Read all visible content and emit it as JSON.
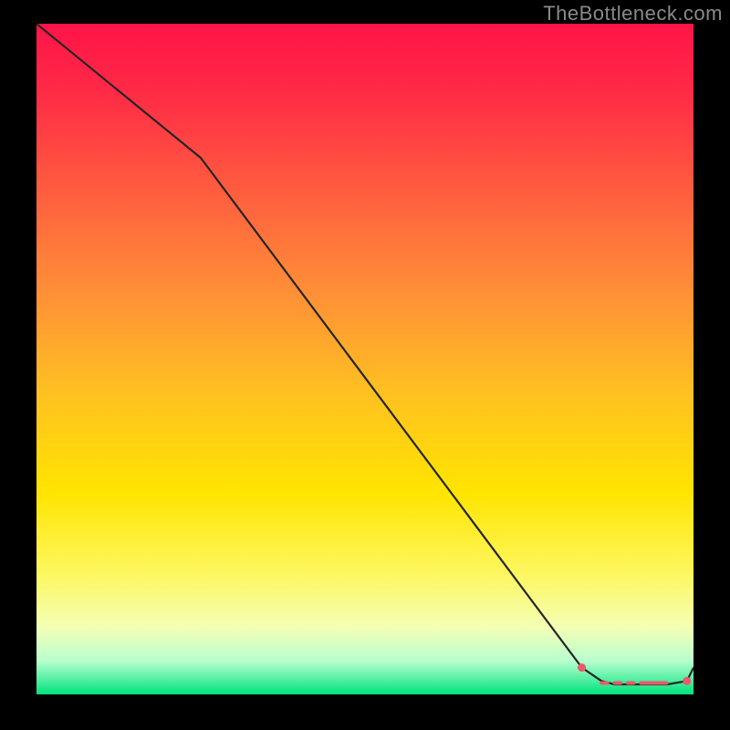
{
  "attribution": "TheBottleneck.com",
  "colors": {
    "top": "#ff1648",
    "mid": "#ffe500",
    "green": "#00e27d",
    "black": "#000000",
    "curve": "#252525",
    "marker": "#ed586c"
  },
  "chart_data": {
    "type": "line",
    "title": "",
    "xlabel": "",
    "ylabel": "",
    "xlim": [
      0,
      100
    ],
    "ylim": [
      0,
      100
    ],
    "grid": false,
    "legend": false,
    "x": [
      0,
      25,
      83,
      86,
      88,
      90,
      92,
      93,
      94,
      95,
      96,
      99,
      100
    ],
    "values": [
      100,
      80,
      4,
      2,
      1.5,
      1.5,
      1.5,
      1.5,
      1.5,
      1.5,
      1.5,
      2,
      4
    ],
    "markers": {
      "start_x": 83,
      "start_y": 4,
      "dash_x": [
        86,
        88,
        90,
        92,
        93,
        94,
        95,
        96
      ],
      "dash_y": 1.7,
      "end_x": 99,
      "end_y": 2
    }
  }
}
